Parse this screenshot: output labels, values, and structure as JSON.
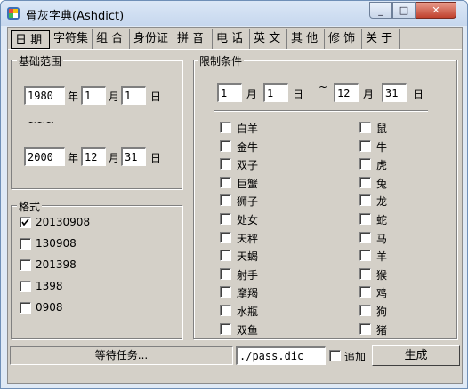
{
  "window": {
    "title": "骨灰字典(Ashdict)",
    "minimize": "_",
    "maximize": "□",
    "close": "✕"
  },
  "tabs": [
    "日 期",
    "字符集",
    "组 合",
    "身份证",
    "拼 音",
    "电 话",
    "英 文",
    "其 他",
    "修 饰",
    "关 于"
  ],
  "base_range": {
    "label": "基础范围",
    "start": {
      "year": "1980",
      "year_unit": "年",
      "month": "1",
      "month_unit": "月",
      "day": "1",
      "day_unit": "日"
    },
    "separator": "~~~",
    "end": {
      "year": "2000",
      "year_unit": "年",
      "month": "12",
      "month_unit": "月",
      "day": "31",
      "day_unit": "日"
    }
  },
  "format": {
    "label": "格式",
    "options": [
      {
        "text": "20130908",
        "checked": true
      },
      {
        "text": "130908",
        "checked": false
      },
      {
        "text": "201398",
        "checked": false
      },
      {
        "text": "1398",
        "checked": false
      },
      {
        "text": "0908",
        "checked": false
      }
    ]
  },
  "limit": {
    "label": "限制条件",
    "from_month": "1",
    "month_unit": "月",
    "from_day": "1",
    "day_unit": "日",
    "tilde": "~",
    "to_month": "12",
    "to_day": "31",
    "zodiac": [
      "白羊",
      "金牛",
      "双子",
      "巨蟹",
      "狮子",
      "处女",
      "天秤",
      "天蝎",
      "射手",
      "摩羯",
      "水瓶",
      "双鱼"
    ],
    "animals": [
      "鼠",
      "牛",
      "虎",
      "兔",
      "龙",
      "蛇",
      "马",
      "羊",
      "猴",
      "鸡",
      "狗",
      "猪"
    ]
  },
  "footer": {
    "status": "等待任务...",
    "output_path": "./pass.dic",
    "append_label": "追加",
    "generate_label": "生成"
  }
}
